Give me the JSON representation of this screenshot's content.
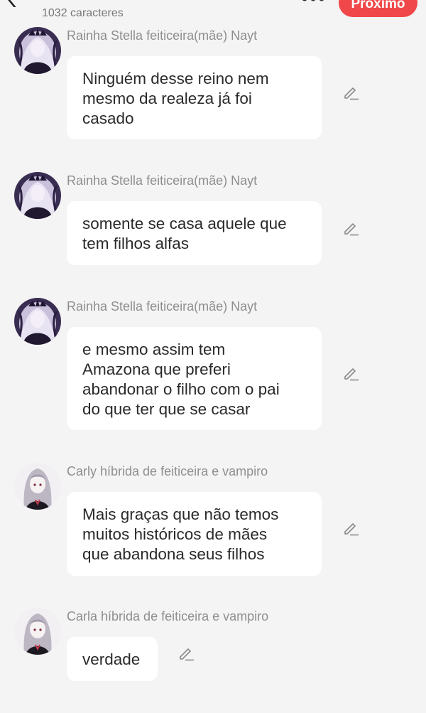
{
  "header": {
    "char_count": "1032 caracteres",
    "next_label": "Próximo",
    "back_icon": "back-chevron-icon",
    "more_icon": "more-dots-icon"
  },
  "colors": {
    "accent": "#f0484a",
    "background": "#f4f4f4",
    "bubble": "#ffffff",
    "sender_text": "#8e8e8e",
    "message_text": "#2a2a2a"
  },
  "messages": [
    {
      "sender": "Rainha Stella feiticeira(mãe) Nayt",
      "lines": [
        "Ninguém desse reino nem",
        "mesmo da realeza já foi",
        "casado"
      ],
      "avatar": "queen-avatar"
    },
    {
      "sender": "Rainha Stella feiticeira(mãe) Nayt",
      "lines": [
        "somente se casa aquele que",
        "tem filhos alfas"
      ],
      "avatar": "queen-avatar"
    },
    {
      "sender": "Rainha Stella feiticeira(mãe) Nayt",
      "lines": [
        "e mesmo assim tem",
        "Amazona que preferi",
        "abandonar o filho com o pai",
        "do que ter que se casar"
      ],
      "avatar": "queen-avatar"
    },
    {
      "sender": "Carly híbrida de feiticeira e vampiro",
      "lines": [
        "Mais graças que não temos",
        "muitos históricos de mães",
        "que abandona seus filhos"
      ],
      "avatar": "girl-avatar"
    },
    {
      "sender": "Carla híbrida de feiticeira e vampiro",
      "lines": [
        "verdade"
      ],
      "avatar": "girl-avatar"
    }
  ],
  "edit_icon": "edit-pencil-icon"
}
